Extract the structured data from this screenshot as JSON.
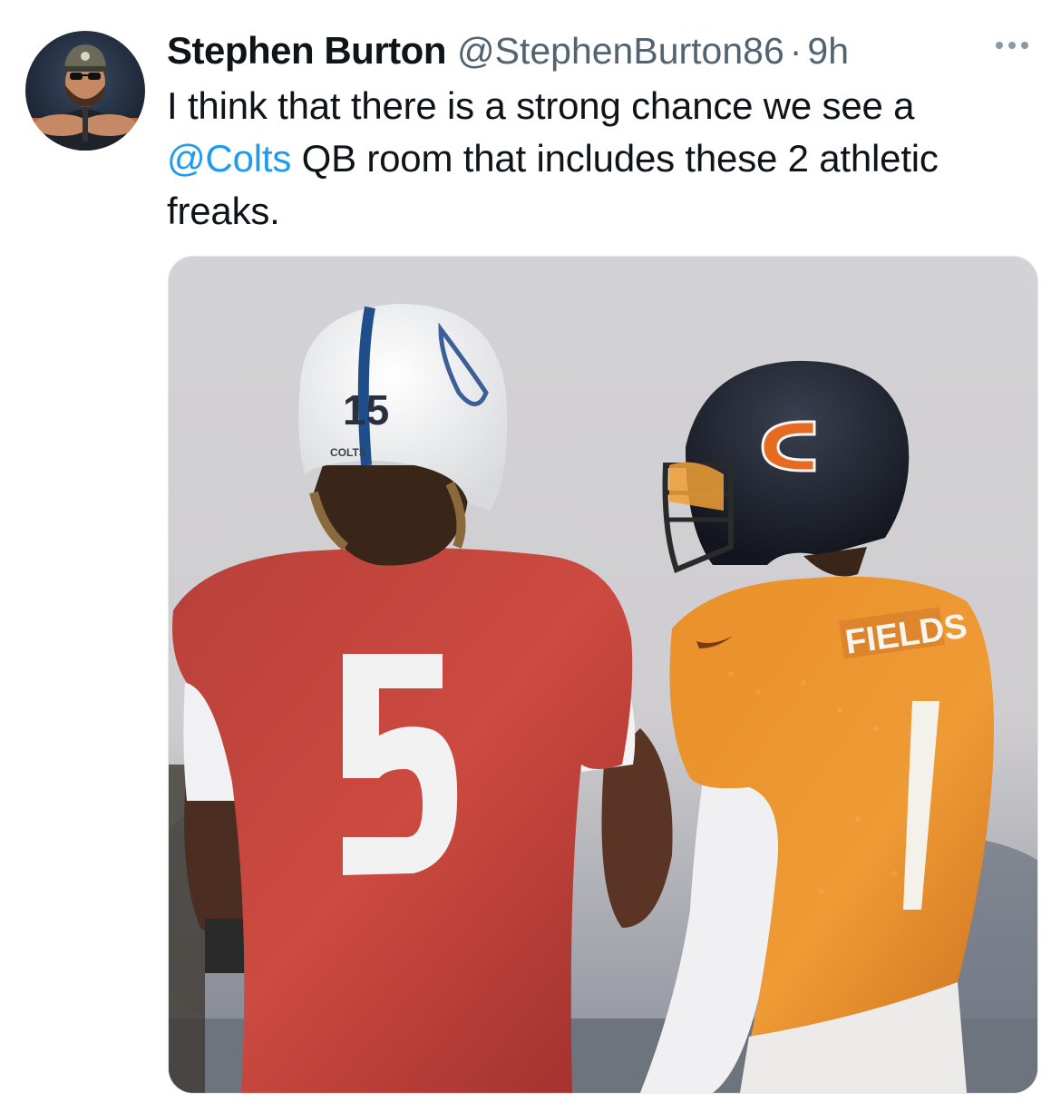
{
  "author": {
    "name": "Stephen Burton",
    "handle": "@StephenBurton86",
    "separator": "·",
    "time": "9h"
  },
  "tweet": {
    "text_before": "I think that there is a strong chance we see a ",
    "mention": "@Colts",
    "text_after": " QB room that includes these 2 athletic freaks."
  },
  "media": {
    "left_jersey_number": "5",
    "left_helmet_number": "15",
    "left_helmet_text": "COLTS",
    "right_jersey_number": "1",
    "right_jersey_name": "FIELDS"
  },
  "colors": {
    "mention": "#1d9bf0",
    "secondary_text": "#536471",
    "colts_red_jersey": "#c8423d",
    "bears_orange_jersey": "#e98b2a",
    "bears_helmet": "#1a1f2c"
  },
  "icons": {
    "more": "more-horizontal-icon",
    "avatar": "avatar-cartoon-icon"
  }
}
